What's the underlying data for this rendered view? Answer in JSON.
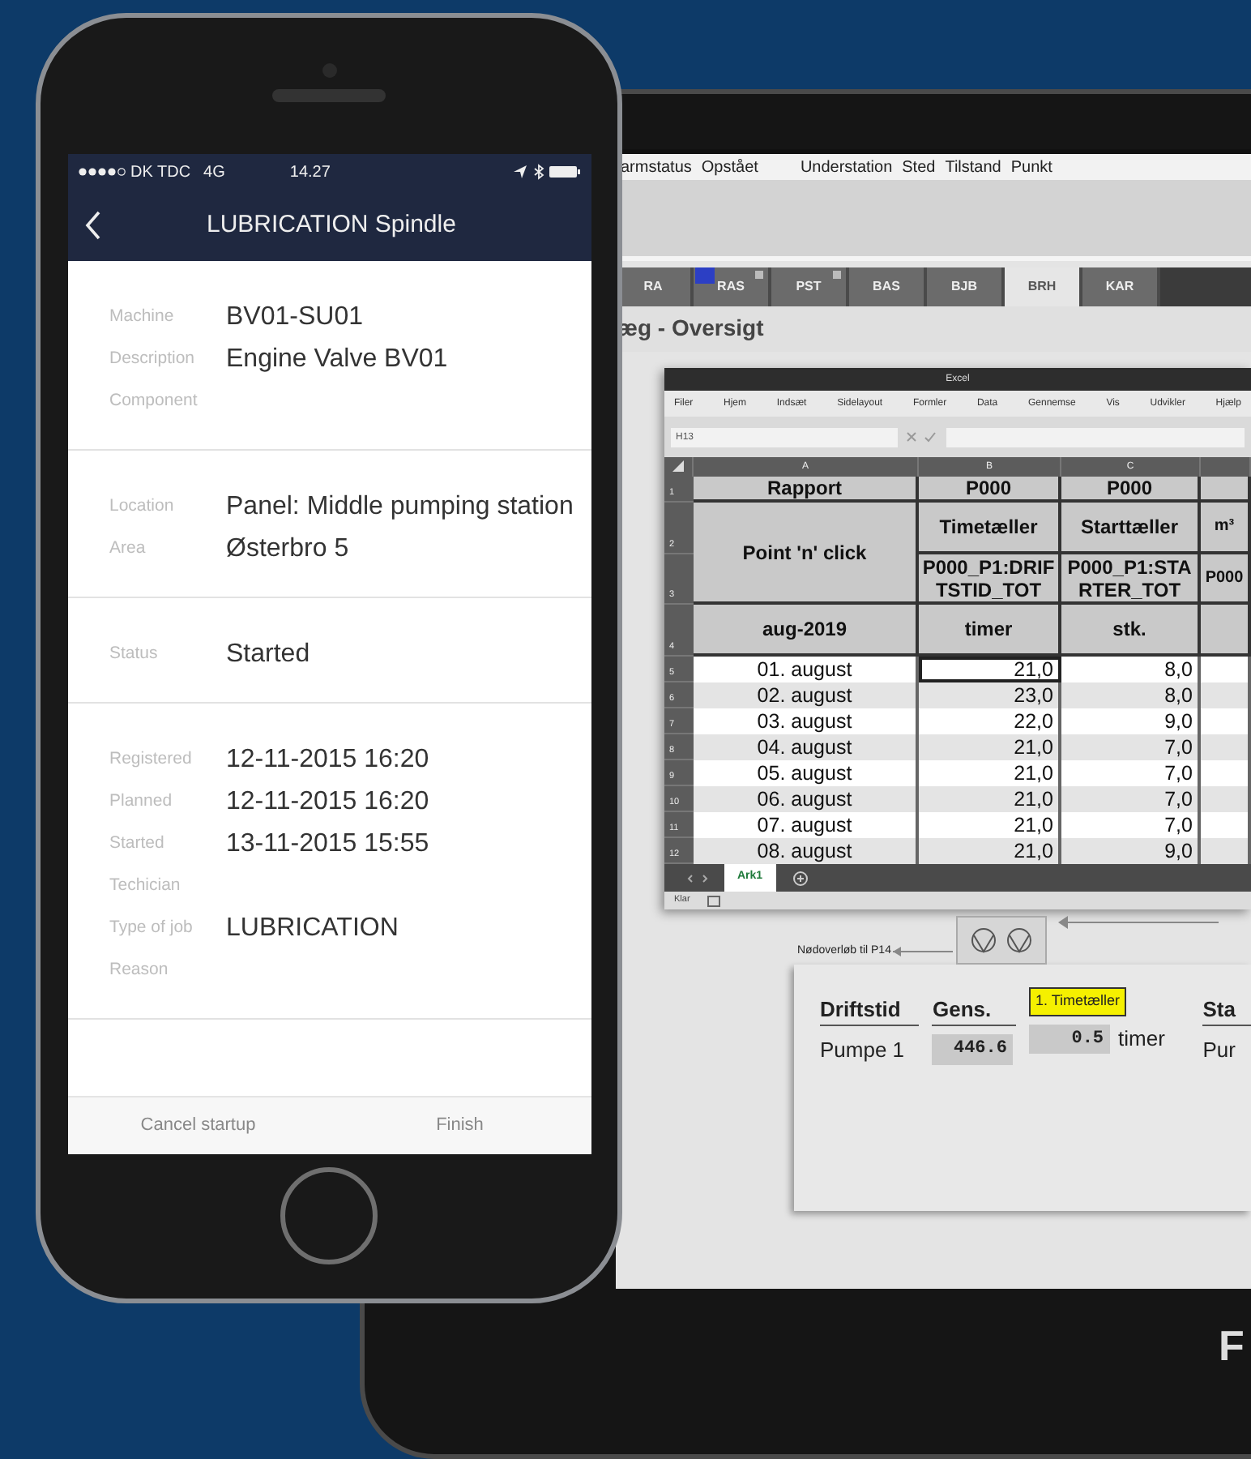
{
  "tablet": {
    "menu_groups": [
      [
        "armstatus",
        "Opstået"
      ],
      [
        "Understation",
        "Sted",
        "Tilstand",
        "Punkt"
      ]
    ],
    "tabs": [
      {
        "label": "RA",
        "selected": false,
        "alarm": false,
        "flag": false
      },
      {
        "label": "RAS",
        "selected": false,
        "alarm": true,
        "flag": true
      },
      {
        "label": "PST",
        "selected": false,
        "alarm": false,
        "flag": true
      },
      {
        "label": "BAS",
        "selected": false,
        "alarm": false,
        "flag": false
      },
      {
        "label": "BJB",
        "selected": false,
        "alarm": false,
        "flag": false
      },
      {
        "label": "BRH",
        "selected": true,
        "alarm": false,
        "flag": false
      },
      {
        "label": "KAR",
        "selected": false,
        "alarm": false,
        "flag": false
      }
    ],
    "page_title": "æg - Oversigt",
    "excel": {
      "title": "Excel",
      "menu": [
        "Filer",
        "Hjem",
        "Indsæt",
        "Sidelayout",
        "Formler",
        "Data",
        "Gennemse",
        "Vis",
        "Udvikler",
        "Hjælp"
      ],
      "name_box": "H13",
      "columns": [
        "A",
        "B",
        "C"
      ],
      "header_rows": [
        {
          "number": "1",
          "cells": [
            {
              "text": "Rapport"
            },
            {
              "text": "P000"
            },
            {
              "text": "P000"
            },
            {}
          ]
        },
        {
          "number": "2",
          "cells": [
            {
              "text": "Point 'n' click",
              "merged_down": true
            },
            {
              "text": "Timetæller"
            },
            {
              "text": "Starttæller"
            },
            {
              "text": "m³"
            }
          ]
        },
        {
          "number": "3",
          "cells": [
            {
              "text": "P000_P1:DRIFTSTID_TOT"
            },
            {
              "text": "P000_P1:STARTER_TOT"
            },
            {
              "text": "P000"
            }
          ]
        },
        {
          "number": "4",
          "cells": [
            {
              "text": "aug-2019"
            },
            {
              "text": "timer"
            },
            {
              "text": "stk."
            },
            {}
          ]
        }
      ],
      "rows": [
        {
          "number": "5",
          "cells": [
            {
              "text": "01. august",
              "selected": false
            },
            {
              "text": "21,0",
              "selected": true
            },
            {
              "text": "8,0",
              "selected": false
            }
          ]
        },
        {
          "number": "6",
          "cells": [
            {
              "text": "02. august",
              "selected": false
            },
            {
              "text": "23,0",
              "selected": false
            },
            {
              "text": "8,0",
              "selected": false
            }
          ]
        },
        {
          "number": "7",
          "cells": [
            {
              "text": "03. august",
              "selected": false
            },
            {
              "text": "22,0",
              "selected": false
            },
            {
              "text": "9,0",
              "selected": false
            }
          ]
        },
        {
          "number": "8",
          "cells": [
            {
              "text": "04. august",
              "selected": false
            },
            {
              "text": "21,0",
              "selected": false
            },
            {
              "text": "7,0",
              "selected": false
            }
          ]
        },
        {
          "number": "9",
          "cells": [
            {
              "text": "05. august",
              "selected": false
            },
            {
              "text": "21,0",
              "selected": false
            },
            {
              "text": "7,0",
              "selected": false
            }
          ]
        },
        {
          "number": "10",
          "cells": [
            {
              "text": "06. august",
              "selected": false
            },
            {
              "text": "21,0",
              "selected": false
            },
            {
              "text": "7,0",
              "selected": false
            }
          ]
        },
        {
          "number": "11",
          "cells": [
            {
              "text": "07. august",
              "selected": false
            },
            {
              "text": "21,0",
              "selected": false
            },
            {
              "text": "7,0",
              "selected": false
            }
          ]
        },
        {
          "number": "12",
          "cells": [
            {
              "text": "08. august",
              "selected": false
            },
            {
              "text": "21,0",
              "selected": false
            },
            {
              "text": "9,0",
              "selected": false
            }
          ]
        }
      ],
      "sheets": [
        {
          "label": "Ark1",
          "selected": true
        }
      ],
      "status": "Klar"
    },
    "diagram": {
      "overflow_label": "Nødoverløb til P14",
      "columns": [
        {
          "kind": "text",
          "header": "Driftstid",
          "value": "Pumpe 1"
        },
        {
          "kind": "readout",
          "header": "Gens.",
          "value": "446.6"
        },
        {
          "kind": "readout",
          "tooltip": "1. Timetæller",
          "value": "0.5",
          "unit": "timer"
        },
        {
          "kind": "text",
          "header": "Sta",
          "value": "Pur"
        }
      ]
    },
    "logo": "F"
  },
  "phone": {
    "status_bar": {
      "carrier": "DK TDC",
      "network": "4G",
      "time": "14.27"
    },
    "title": "LUBRICATION Spindle",
    "sections": [
      {
        "fields": [
          {
            "label": "Machine",
            "value": "BV01-SU01"
          },
          {
            "label": "Description",
            "value": "Engine Valve BV01"
          },
          {
            "label": "Component"
          }
        ]
      },
      {
        "fields": [
          {
            "label": "Location",
            "value": "Panel: Middle pumping station"
          },
          {
            "label": "Area",
            "value": "Østerbro 5"
          }
        ]
      },
      {
        "fields": [
          {
            "label": "Status",
            "value": "Started"
          }
        ]
      },
      {
        "fields": [
          {
            "label": "Registered",
            "value": "12-11-2015 16:20"
          },
          {
            "label": "Planned",
            "value": "12-11-2015 16:20"
          },
          {
            "label": "Started",
            "value": "13-11-2015 15:55"
          },
          {
            "label": "Techician"
          },
          {
            "label": "Type of job",
            "value": "LUBRICATION"
          },
          {
            "label": "Reason"
          }
        ]
      }
    ],
    "actions": [
      "Cancel startup",
      "Finish"
    ]
  }
}
